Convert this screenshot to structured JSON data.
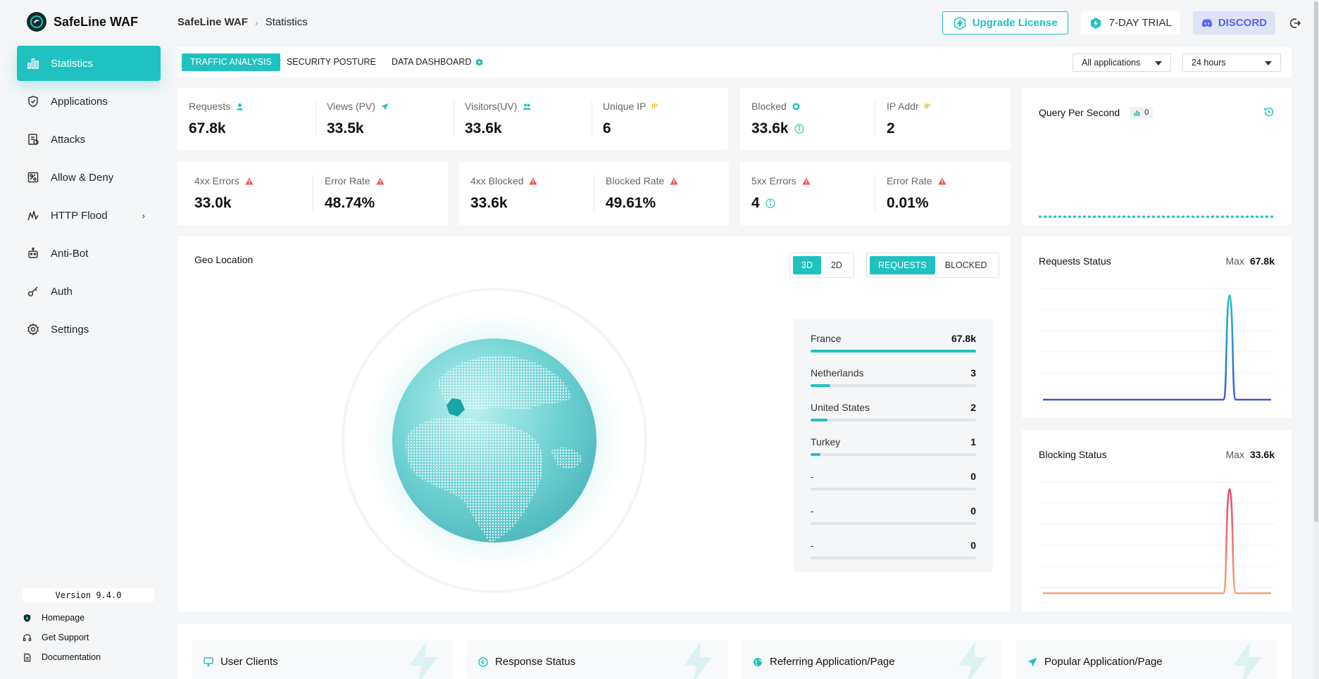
{
  "brand": {
    "title": "SafeLine WAF",
    "logo_icon": "safeline-logo-icon"
  },
  "nav": [
    {
      "label": "Statistics",
      "icon": "bar-chart-icon",
      "active": true
    },
    {
      "label": "Applications",
      "icon": "shield-icon"
    },
    {
      "label": "Attacks",
      "icon": "attack-log-icon"
    },
    {
      "label": "Allow & Deny",
      "icon": "allow-deny-icon"
    },
    {
      "label": "HTTP Flood",
      "icon": "flood-icon",
      "has_submenu": true
    },
    {
      "label": "Anti-Bot",
      "icon": "robot-icon"
    },
    {
      "label": "Auth",
      "icon": "key-icon"
    },
    {
      "label": "Settings",
      "icon": "gear-icon"
    }
  ],
  "version": "Version 9.4.0",
  "footer_links": [
    {
      "label": "Homepage",
      "icon": "shield-home-icon"
    },
    {
      "label": "Get Support",
      "icon": "support-icon"
    },
    {
      "label": "Documentation",
      "icon": "document-icon"
    }
  ],
  "breadcrumb": {
    "root": "SafeLine WAF",
    "current": "Statistics"
  },
  "header": {
    "upgrade": "Upgrade License",
    "trial": "7-DAY TRIAL",
    "discord": "DISCORD"
  },
  "tabs": [
    {
      "label": "TRAFFIC ANALYSIS",
      "active": true
    },
    {
      "label": "SECURITY POSTURE"
    },
    {
      "label": "DATA DASHBOARD"
    }
  ],
  "filters": {
    "application": "All applications",
    "range": "24 hours"
  },
  "stats_top": [
    {
      "label": "Requests",
      "value": "67.8k"
    },
    {
      "label": "Views (PV)",
      "value": "33.5k"
    },
    {
      "label": "Visitors(UV)",
      "value": "33.6k"
    },
    {
      "label": "Unique IP",
      "value": "6",
      "badge": "IP"
    }
  ],
  "stats_blocked": [
    {
      "label": "Blocked",
      "value": "33.6k"
    },
    {
      "label": "IP Addr",
      "value": "2",
      "badge": "IP"
    }
  ],
  "stats_errors_4xx": [
    {
      "label": "4xx Errors",
      "value": "33.0k"
    },
    {
      "label": "Error Rate",
      "value": "48.74%"
    }
  ],
  "stats_blocked_4xx": [
    {
      "label": "4xx Blocked",
      "value": "33.6k"
    },
    {
      "label": "Blocked Rate",
      "value": "49.61%"
    }
  ],
  "stats_errors_5xx": [
    {
      "label": "5xx Errors",
      "value": "4"
    },
    {
      "label": "Error Rate",
      "value": "0.01%"
    }
  ],
  "qps": {
    "title": "Query Per Second",
    "value": "0"
  },
  "geo": {
    "title": "Geo Location",
    "view_modes": [
      "3D",
      "2D"
    ],
    "active_view": "3D",
    "metrics": [
      "REQUESTS",
      "BLOCKED"
    ],
    "active_metric": "REQUESTS",
    "countries": [
      {
        "name": "France",
        "value": "67.8k",
        "fraction": 1.0
      },
      {
        "name": "Netherlands",
        "value": "3",
        "fraction": 0.12
      },
      {
        "name": "United States",
        "value": "2",
        "fraction": 0.1
      },
      {
        "name": "Turkey",
        "value": "1",
        "fraction": 0.06
      },
      {
        "name": "-",
        "value": "0",
        "fraction": 0
      },
      {
        "name": "-",
        "value": "0",
        "fraction": 0
      },
      {
        "name": "-",
        "value": "0",
        "fraction": 0
      }
    ]
  },
  "requests_status": {
    "title": "Requests Status",
    "max_label": "Max",
    "max_value": "67.8k",
    "color_start": "#1fc2c0",
    "color_end": "#3d55e0"
  },
  "blocking_status": {
    "title": "Blocking Status",
    "max_label": "Max",
    "max_value": "33.6k",
    "color_start": "#e8466a",
    "color_end": "#f5a27a"
  },
  "bottom_cards": [
    {
      "label": "User Clients",
      "icon": "monitor-icon"
    },
    {
      "label": "Response Status",
      "icon": "status-icon"
    },
    {
      "label": "Referring Application/Page",
      "icon": "globe-icon"
    },
    {
      "label": "Popular Application/Page",
      "icon": "send-icon"
    }
  ],
  "colors": {
    "accent": "#1fc2c0",
    "warn": "#f05151",
    "ip_badge": "#f0b400"
  }
}
